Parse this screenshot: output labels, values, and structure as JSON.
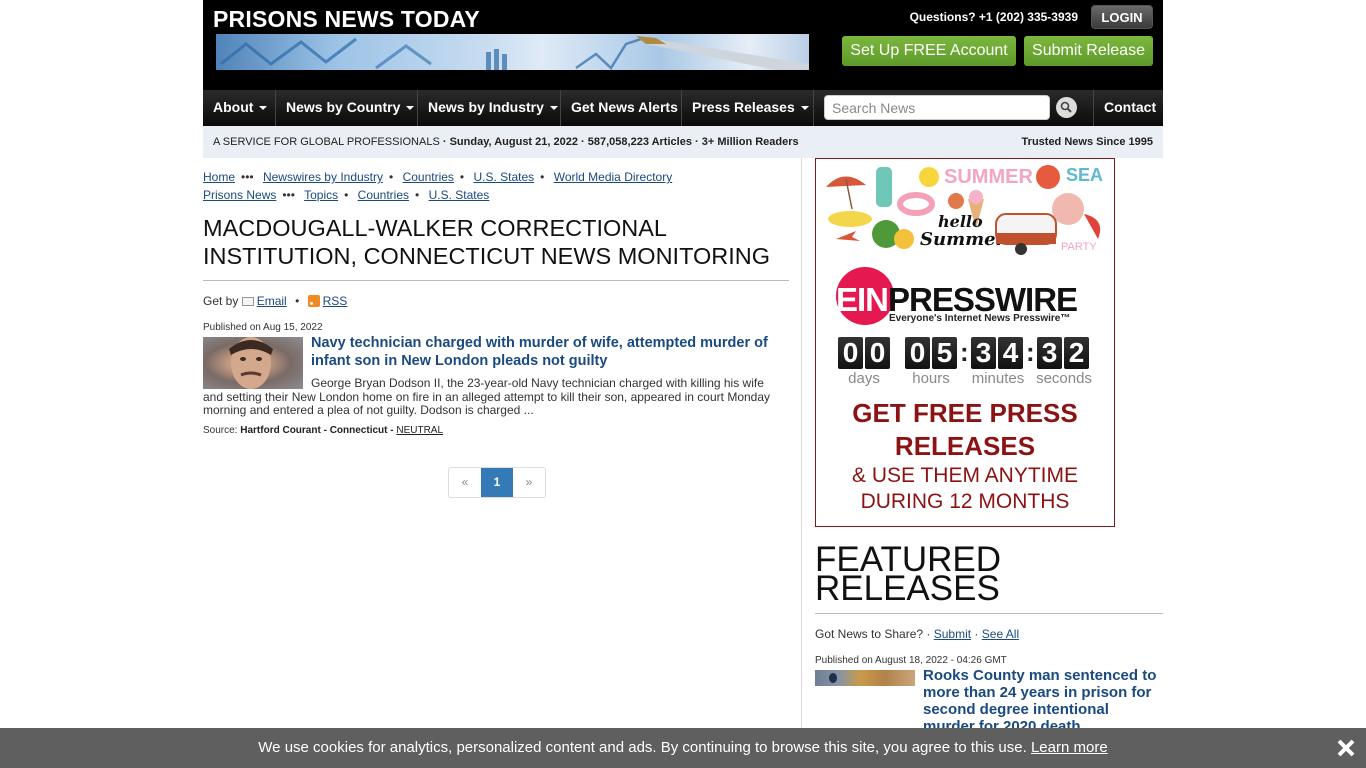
{
  "header": {
    "site_title": "PRISONS NEWS TODAY",
    "questions": "Questions? +1 (202) 335-3939",
    "login_label": "LOGIN",
    "setup_account_label": "Set Up FREE Account",
    "submit_release_label": "Submit Release"
  },
  "nav": {
    "items": [
      {
        "label": "About",
        "dropdown": true
      },
      {
        "label": "News by Country",
        "dropdown": true
      },
      {
        "label": "News by Industry",
        "dropdown": true
      },
      {
        "label": "Get News Alerts",
        "dropdown": false
      },
      {
        "label": "Press Releases",
        "dropdown": true
      }
    ],
    "search_placeholder": "Search News",
    "search_value": "",
    "contact_label": "Contact"
  },
  "infobar": {
    "service": "A SERVICE FOR GLOBAL PROFESSIONALS",
    "date": "Sunday, August 21, 2022",
    "articles": "587,058,223 Articles",
    "readers": "3+ Million Readers",
    "trusted": "Trusted News Since 1995"
  },
  "breadcrumbs": {
    "row1": [
      "Home",
      "Newswires by Industry",
      "Countries",
      "U.S. States",
      "World Media Directory"
    ],
    "row2": [
      "Prisons News",
      "Topics",
      "Countries",
      "U.S. States"
    ]
  },
  "page": {
    "title": "MACDOUGALL-WALKER CORRECTIONAL INSTITUTION, CONNECTICUT NEWS MONITORING",
    "get_by": "Get by",
    "email_label": "Email",
    "rss_label": "RSS"
  },
  "article": {
    "published": "Published on Aug 15, 2022",
    "title": "Navy technician charged with murder of wife, attempted murder of infant son in New London pleads not guilty",
    "snippet": "George Bryan Dodson II, the 23-year-old Navy technician charged with killing his wife and setting their New London home on fire in an alleged attempt to kill their son, appeared in court Monday morning and entered a plea of not guilty. Dodson is charged ...",
    "source_label": "Source:",
    "source": "Hartford Courant - Connecticut -",
    "sentiment": "NEUTRAL"
  },
  "pagination": {
    "prev": "«",
    "current": "1",
    "next": "»"
  },
  "ad": {
    "brand_ein": "EIN",
    "brand_presswire": "PRESSWIRE",
    "tagline": "Everyone's Internet News Presswire™",
    "countdown": {
      "days": [
        "0",
        "0"
      ],
      "hours": [
        "0",
        "5"
      ],
      "minutes": [
        "3",
        "4"
      ],
      "seconds": [
        "3",
        "2"
      ],
      "labels": {
        "days": "days",
        "hours": "hours",
        "minutes": "minutes",
        "seconds": "seconds"
      }
    },
    "headline": "GET FREE PRESS RELEASES",
    "subline": "& USE THEM ANYTIME DURING 12 MONTHS",
    "banner_words": {
      "summer": "SUMMER",
      "sea": "SEA",
      "hello": "hello",
      "summer_script": "Summer",
      "party": "PARTY"
    },
    "accent_color": "#8b1313",
    "brand_color": "#e5194f"
  },
  "featured": {
    "title": "FEATURED RELEASES",
    "got_news": "Got News to Share?",
    "submit_label": "Submit",
    "see_all_label": "See All",
    "published": "Published on August 18, 2022 - 04:26 GMT",
    "item_title": "Rooks County man sentenced to more than 24 years in prison for second degree intentional murder for 2020 death"
  },
  "cookie": {
    "message": "We use cookies for analytics, personalized content and ads. By continuing to browse this site, you agree to this use.",
    "learn_more": "Learn more"
  }
}
